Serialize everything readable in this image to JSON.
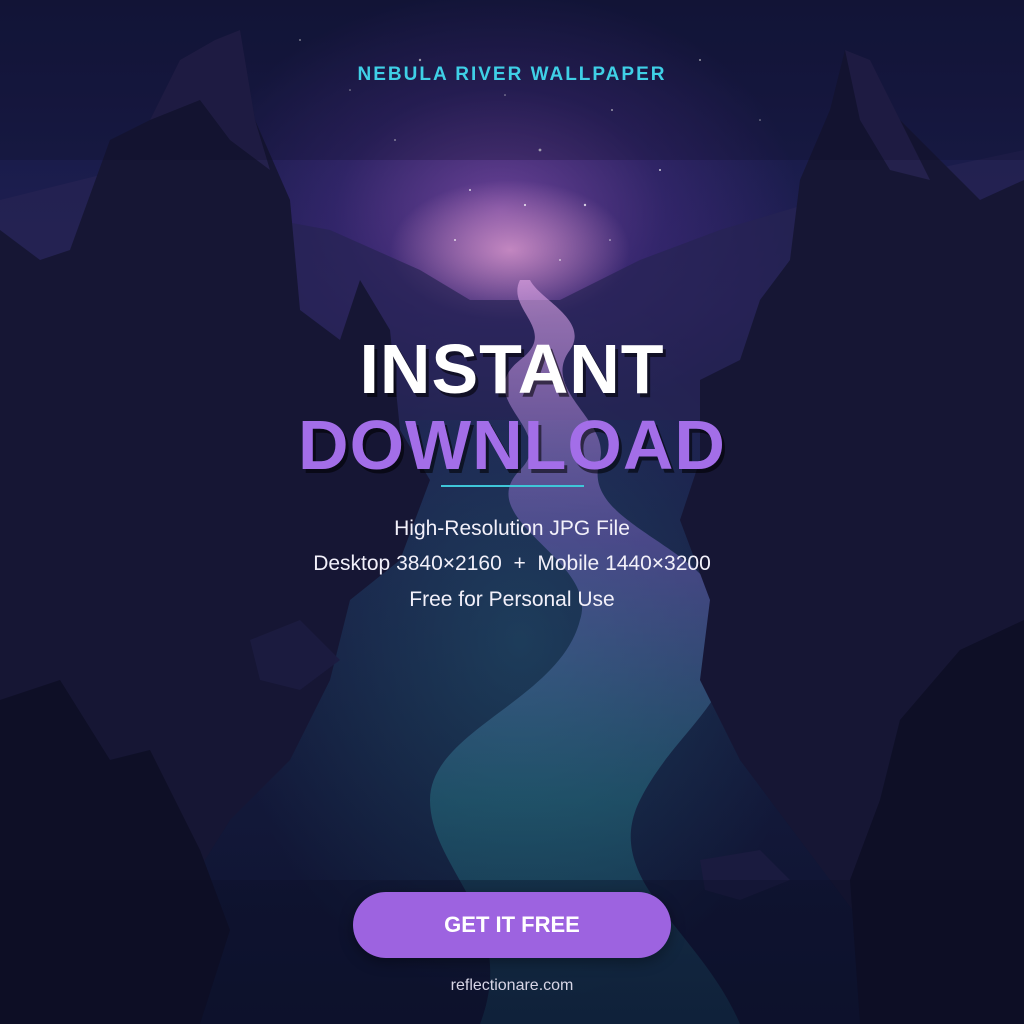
{
  "header": {
    "kicker": "NEBULA RIVER WALLPAPER"
  },
  "hero": {
    "line1": "INSTANT",
    "line2": "DOWNLOAD"
  },
  "details": {
    "line1": "High-Resolution JPG File",
    "line2": "Desktop 3840×2160  +  Mobile 1440×3200",
    "line3": "Free for Personal Use"
  },
  "cta": {
    "label": "GET IT FREE"
  },
  "footer": {
    "site": "reflectionare.com"
  },
  "colors": {
    "accent_cyan": "#3fd0e6",
    "accent_purple": "#a36ee8",
    "button_purple": "#9d63e0",
    "background_navy": "#14173d"
  }
}
